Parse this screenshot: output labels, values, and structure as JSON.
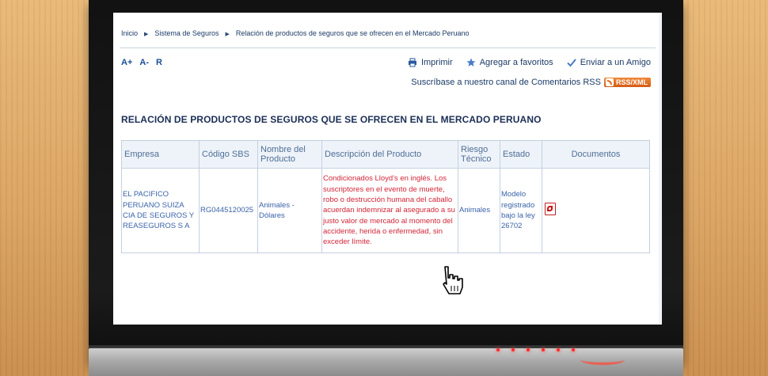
{
  "breadcrumb": {
    "items": [
      "Inicio",
      "Sistema de Seguros",
      "Relación de productos de seguros que se ofrecen en el Mercado Peruano"
    ]
  },
  "font_controls": [
    "A+",
    "A-",
    "R"
  ],
  "actions": {
    "print": "Imprimir",
    "favorites": "Agregar a favoritos",
    "send": "Enviar a un Amigo"
  },
  "rss": {
    "label": "Suscríbase a nuestro canal de Comentarios RSS",
    "badge": "RSS/XML"
  },
  "page_title": "RELACIÓN DE PRODUCTOS DE SEGUROS QUE SE OFRECEN EN EL MERCADO PERUANO",
  "table": {
    "headers": [
      "Empresa",
      "Código SBS",
      "Nombre del Producto",
      "Descripción del Producto",
      "Riesgo Técnico",
      "Estado",
      "Documentos"
    ],
    "rows": [
      {
        "empresa": "EL PACIFICO PERUANO SUIZA CIA DE SEGUROS Y REASEGUROS S A",
        "codigo": "RG0445120025",
        "nombre": "Animales - Dólares",
        "descripcion": "Condicionados Lloyd's en inglés. Los suscriptores en el evento de muerte, robo o destrucción humana del caballo acuerdan indemnizar al asegurado a su justo valor de mercado al momento del accidente, herida o enfermedad, sin exceder límite.",
        "riesgo": "Animales",
        "estado": "Modelo registrado bajo la ley 26702",
        "documento_icon": "pdf-icon"
      }
    ]
  },
  "colors": {
    "link_blue": "#3a63a8",
    "title_navy": "#1b2e55",
    "description_red": "#d12638",
    "rss_orange": "#e06818"
  }
}
